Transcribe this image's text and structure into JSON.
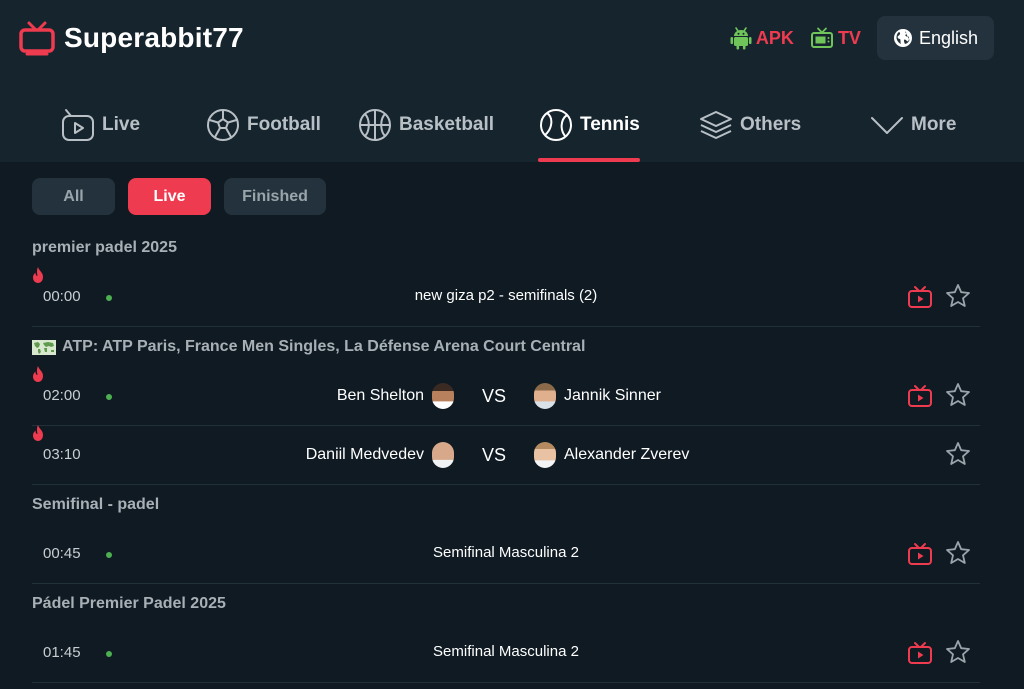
{
  "header": {
    "brand": "Superabbit77",
    "apk_label": "APK",
    "tv_label": "TV",
    "language": "English"
  },
  "nav": [
    {
      "label": "Live",
      "icon": "live-play-icon",
      "active": false
    },
    {
      "label": "Football",
      "icon": "football-icon",
      "active": false
    },
    {
      "label": "Basketball",
      "icon": "basketball-icon",
      "active": false
    },
    {
      "label": "Tennis",
      "icon": "tennis-icon",
      "active": true
    },
    {
      "label": "Others",
      "icon": "layers-icon",
      "active": false
    },
    {
      "label": "More",
      "icon": "chevron-down-icon",
      "active": false
    }
  ],
  "filters": [
    {
      "label": "All",
      "active": false
    },
    {
      "label": "Live",
      "active": true
    },
    {
      "label": "Finished",
      "active": false
    }
  ],
  "leagues": [
    {
      "name": "premier padel 2025",
      "matches": [
        {
          "time": "00:00",
          "title": "new giza p2 - semifinals (2)",
          "hot": true,
          "live_dot": true,
          "stream": true
        }
      ]
    },
    {
      "name": "ATP: ATP Paris, France Men Singles, La Défense Arena Court Central",
      "matches": [
        {
          "time": "02:00",
          "home": "Ben Shelton",
          "vs": "VS",
          "away": "Jannik Sinner",
          "hot": true,
          "live_dot": true,
          "stream": true
        },
        {
          "time": "03:10",
          "home": "Daniil Medvedev",
          "vs": "VS",
          "away": "Alexander Zverev",
          "hot": true,
          "live_dot": false,
          "stream": false
        }
      ]
    },
    {
      "name": "Semifinal - padel",
      "matches": [
        {
          "time": "00:45",
          "title": "Semifinal Masculina 2",
          "hot": false,
          "live_dot": true,
          "stream": true
        }
      ]
    },
    {
      "name": "Pádel Premier Padel 2025",
      "matches": [
        {
          "time": "01:45",
          "title": "Semifinal Masculina 2",
          "hot": false,
          "live_dot": true,
          "stream": true
        }
      ]
    }
  ],
  "colors": {
    "accent": "#ee3b4f",
    "background": "#0f1a22",
    "header": "#16242d",
    "live_dot": "#4caf50"
  }
}
